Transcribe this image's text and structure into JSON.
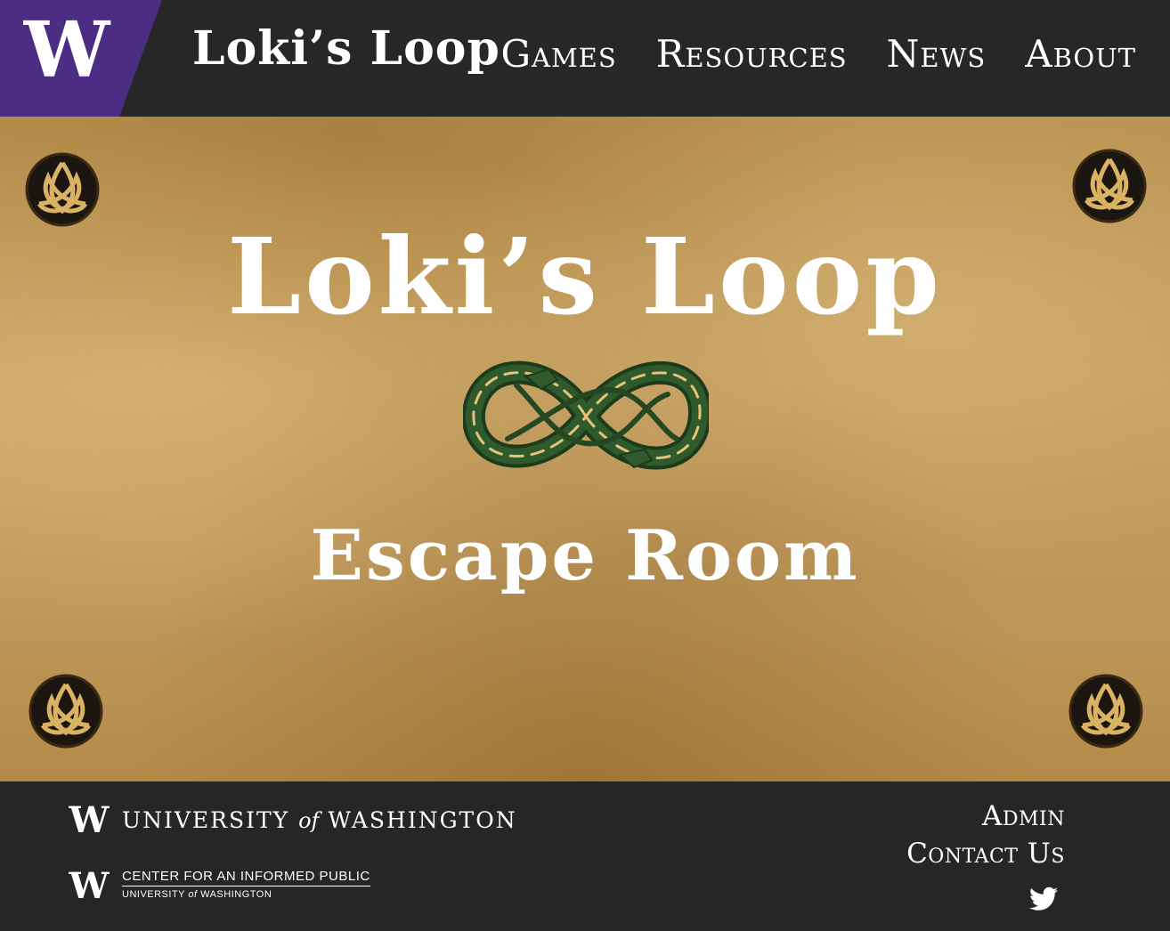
{
  "header": {
    "logo_letter": "W",
    "site_title": "Loki’s Loop",
    "nav": [
      {
        "label": "Games"
      },
      {
        "label": "Resources"
      },
      {
        "label": "News"
      },
      {
        "label": "About"
      }
    ]
  },
  "hero": {
    "title": "Loki’s Loop",
    "subtitle": "Escape Room",
    "decor_icons": [
      "triquetra-knot-icon",
      "serpent-infinity-icon"
    ]
  },
  "footer": {
    "uw_wordmark": {
      "pre": "UNIVERSITY",
      "of": "of",
      "post": "WASHINGTON"
    },
    "cip": {
      "line1": "CENTER FOR AN INFORMED PUBLIC",
      "line2_pre": "UNIVERSITY",
      "line2_of": "of",
      "line2_post": "WASHINGTON"
    },
    "links": [
      {
        "label": "Admin"
      },
      {
        "label": "Contact Us"
      }
    ],
    "social_icon": "twitter-icon"
  },
  "colors": {
    "uw_purple": "#4b2e83",
    "header_bg": "#272727",
    "parchment": "#c29c5e",
    "serpent_green": "#2f5a2c"
  }
}
